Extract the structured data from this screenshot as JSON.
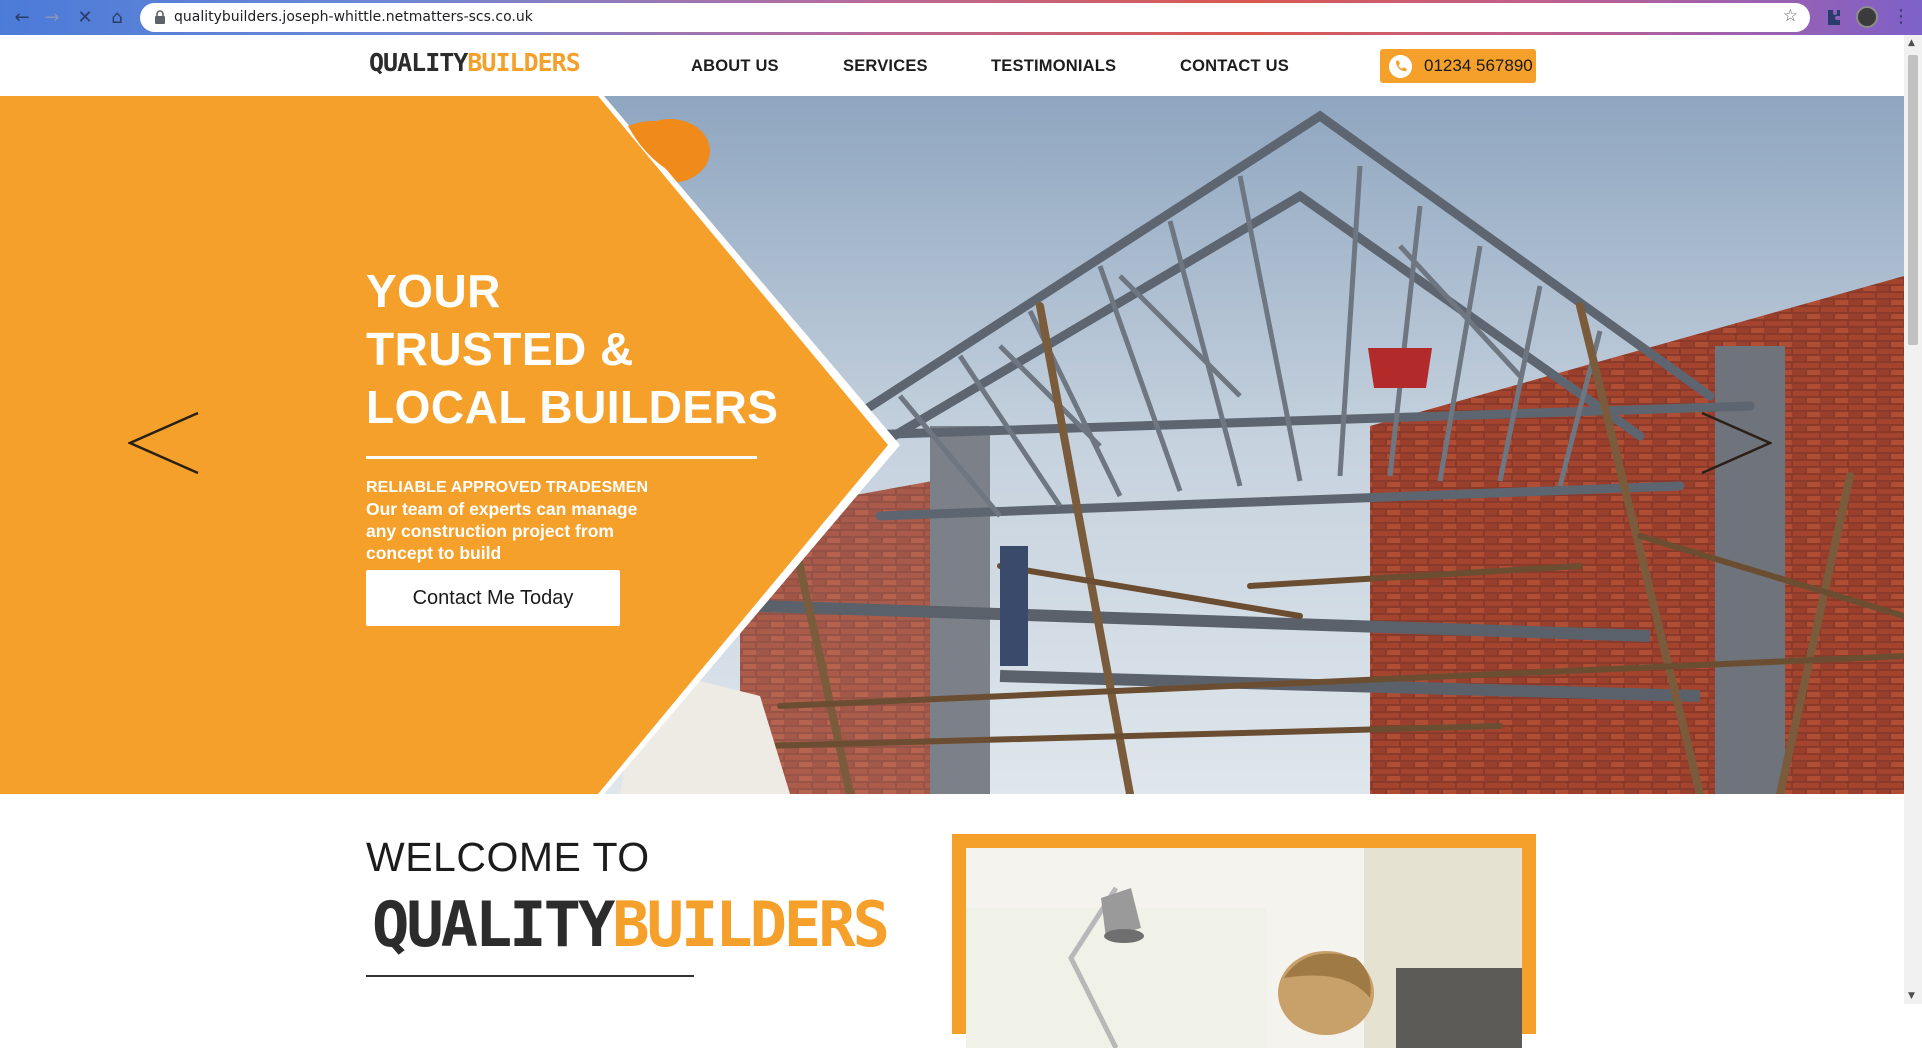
{
  "browser": {
    "url": "qualitybuilders.joseph-whittle.netmatters-scs.co.uk"
  },
  "header": {
    "logo_part1": "QUALITY",
    "logo_part2": "BUILDERS",
    "nav": [
      "ABOUT US",
      "SERVICES",
      "TESTIMONIALS",
      "CONTACT US"
    ],
    "phone": "01234 567890"
  },
  "hero": {
    "title_lines": [
      "YOUR",
      "TRUSTED &",
      "LOCAL BUILDERS"
    ],
    "subtitle": "RELIABLE APPROVED TRADESMEN",
    "text": "Our team of experts can manage any construction project from concept to build",
    "button": "Contact Me Today"
  },
  "welcome": {
    "heading": "WELCOME TO",
    "logo_part1": "QUALITY",
    "logo_part2": "BUILDERS"
  },
  "colors": {
    "accent": "#f5a02a",
    "dark": "#2c2c2c"
  }
}
